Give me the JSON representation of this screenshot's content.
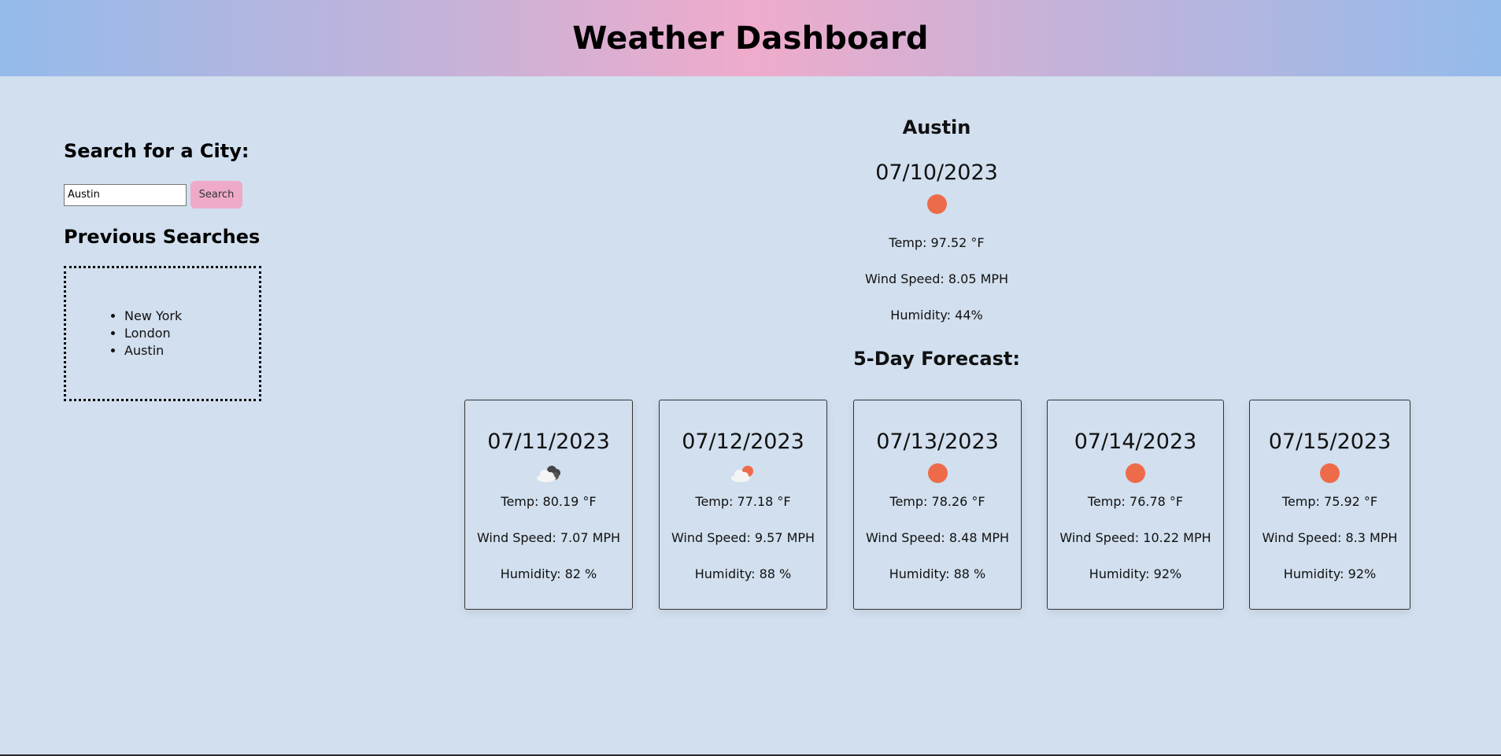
{
  "header": {
    "title": "Weather Dashboard"
  },
  "sidebar": {
    "search_title": "Search for a City:",
    "search_value": "Austin",
    "search_button": "Search",
    "previous_title": "Previous Searches",
    "previous": [
      "New York",
      "London",
      "Austin"
    ]
  },
  "current": {
    "city": "Austin",
    "date": "07/10/2023",
    "icon": "sun-icon",
    "temp": "Temp: 97.52 °F",
    "wind": "Wind Speed: 8.05 MPH",
    "humidity": "Humidity: 44%"
  },
  "forecast": {
    "title": "5-Day Forecast:",
    "days": [
      {
        "date": "07/11/2023",
        "icon": "broken-clouds-icon",
        "temp": "Temp: 80.19 °F",
        "wind": "Wind Speed: 7.07 MPH",
        "humidity": "Humidity: 82 %"
      },
      {
        "date": "07/12/2023",
        "icon": "few-clouds-icon",
        "temp": "Temp: 77.18 °F",
        "wind": "Wind Speed: 9.57 MPH",
        "humidity": "Humidity: 88 %"
      },
      {
        "date": "07/13/2023",
        "icon": "sun-icon",
        "temp": "Temp: 78.26 °F",
        "wind": "Wind Speed: 8.48 MPH",
        "humidity": "Humidity: 88 %"
      },
      {
        "date": "07/14/2023",
        "icon": "sun-icon",
        "temp": "Temp: 76.78 °F",
        "wind": "Wind Speed: 10.22 MPH",
        "humidity": "Humidity: 92%"
      },
      {
        "date": "07/15/2023",
        "icon": "sun-icon",
        "temp": "Temp: 75.92 °F",
        "wind": "Wind Speed: 8.3 MPH",
        "humidity": "Humidity: 92%"
      }
    ]
  },
  "colors": {
    "background": "#d1dfee",
    "accent_pink": "#eeaac8",
    "header_blue": "#94bbeb",
    "sun": "#ee6b4a"
  }
}
